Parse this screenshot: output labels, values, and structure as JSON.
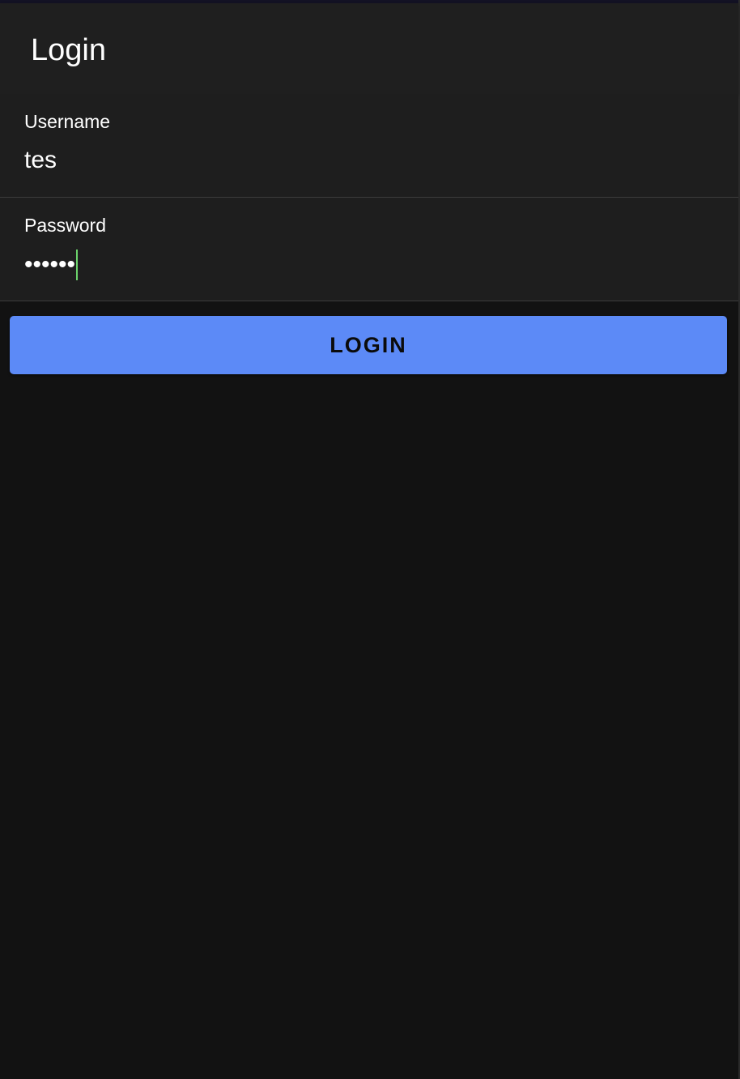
{
  "header": {
    "title": "Login"
  },
  "form": {
    "username": {
      "label": "Username",
      "value": "tes"
    },
    "password": {
      "label": "Password",
      "masked_value": "••••••"
    },
    "submit_label": "LOGIN"
  },
  "colors": {
    "background": "#121212",
    "surface": "#1e1e1e",
    "accent": "#5c8af7",
    "caret": "#6bd36b",
    "text": "#ffffff"
  }
}
